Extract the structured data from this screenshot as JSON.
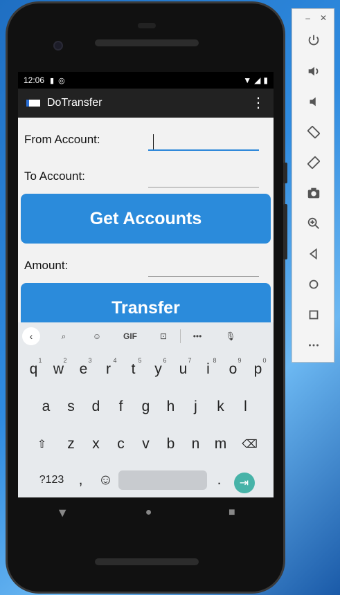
{
  "status_bar": {
    "time": "12:06"
  },
  "app": {
    "title": "DoTransfer",
    "overflow_icon": "more-vert-icon"
  },
  "form": {
    "from_label": "From Account:",
    "from_value": "",
    "to_label": "To Account:",
    "to_value": "",
    "amount_label": "Amount:",
    "amount_value": ""
  },
  "buttons": {
    "get_accounts": "Get Accounts",
    "transfer": "Transfer"
  },
  "keyboard": {
    "toolbar": {
      "gif": "GIF",
      "more": "•••"
    },
    "row1": [
      {
        "k": "q",
        "n": "1"
      },
      {
        "k": "w",
        "n": "2"
      },
      {
        "k": "e",
        "n": "3"
      },
      {
        "k": "r",
        "n": "4"
      },
      {
        "k": "t",
        "n": "5"
      },
      {
        "k": "y",
        "n": "6"
      },
      {
        "k": "u",
        "n": "7"
      },
      {
        "k": "i",
        "n": "8"
      },
      {
        "k": "o",
        "n": "9"
      },
      {
        "k": "p",
        "n": "0"
      }
    ],
    "row2": [
      "a",
      "s",
      "d",
      "f",
      "g",
      "h",
      "j",
      "k",
      "l"
    ],
    "row3": [
      "z",
      "x",
      "c",
      "v",
      "b",
      "n",
      "m"
    ],
    "symbols_label": "?123",
    "comma": ",",
    "period": "."
  },
  "colors": {
    "accent": "#2b8bdb",
    "go_button": "#47b3a8",
    "appbar": "#222222"
  }
}
